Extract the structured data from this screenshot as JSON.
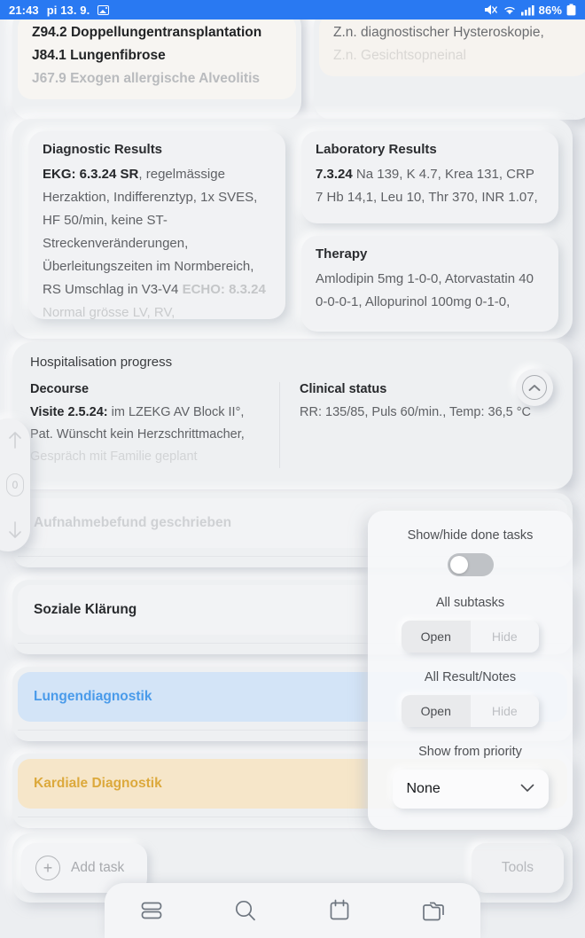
{
  "status_bar": {
    "time": "21:43",
    "date": "pi 13. 9.",
    "battery": "86%",
    "icons": [
      "image-icon",
      "mute-icon",
      "wifi-icon",
      "signal-icon",
      "battery-icon"
    ]
  },
  "diagnoses_left": {
    "lines": [
      "Z94.2 Doppellungentransplantation",
      "J84.1 Lungenfibrose",
      "J67.9 Exogen allergische Alveolitis"
    ]
  },
  "diagnoses_right": {
    "lines": [
      "Z.n. diagnostischer Hysteroskopie,",
      "Z.n. Gesichtsopneinal"
    ]
  },
  "diagnostic_results": {
    "title": "Diagnostic Results",
    "entry_label": "EKG: 6.3.24 SR",
    "entry_text": ", regelmässige Herzaktion, Indifferenztyp, 1x SVES, HF 50/min, keine ST-Streckenveränderungen, Überleitungszeiten im Normbereich, RS Umschlag in V3-V4",
    "faded_label": "ECHO: 8.3.24",
    "faded_text": " Normal grösse LV, RV,"
  },
  "laboratory_results": {
    "title": "Laboratory Results",
    "date": "7.3.24",
    "text": " Na 139, K 4.7, Krea 131, CRP 7 Hb 14,1, Leu 10, Thr 370, INR 1.07,"
  },
  "therapy": {
    "title": "Therapy",
    "text": "Amlodipin 5mg 1-0-0, Atorvastatin 40 0-0-0-1, Allopurinol 100mg 0-1-0,"
  },
  "hospitalisation": {
    "title": "Hospitalisation progress",
    "decourse_head": "Decourse",
    "decourse_label": "Visite 2.5.24:",
    "decourse_text": " im LZEKG AV Block II°, Pat. Wünscht kein Herzschrittmacher,",
    "decourse_faded": "Gespräch mit Familie geplant",
    "status_head": "Clinical status",
    "status_text": "RR: 135/85, Puls 60/min., Temp: 36,5 °C"
  },
  "side_nav": {
    "count": "0"
  },
  "tasks": [
    {
      "label": "Aufnahmebefund geschrieben",
      "style": "plain"
    },
    {
      "label": "Soziale Klärung",
      "style": "normal"
    },
    {
      "label": "Lungendiagnostik",
      "style": "blue"
    },
    {
      "label": "Kardiale Diagnostik",
      "style": "amber"
    }
  ],
  "action_bar": {
    "add_task": "Add task",
    "tools": "Tools"
  },
  "bottom_nav": {
    "items": [
      "list-icon",
      "search-icon",
      "calendar-icon",
      "folders-icon"
    ]
  },
  "popover": {
    "show_hide_done_label": "Show/hide done tasks",
    "toggle_state": "off",
    "all_subtasks_label": "All subtasks",
    "all_subtasks_open": "Open",
    "all_subtasks_hide": "Hide",
    "all_results_label": "All Result/Notes",
    "all_results_open": "Open",
    "all_results_hide": "Hide",
    "priority_label": "Show from priority",
    "priority_value": "None"
  },
  "colors": {
    "status_bar": "#2979f2",
    "background": "#eceef1",
    "task_blue_bg": "#d3e4f7",
    "task_blue_text": "#4a9bea",
    "task_amber_bg": "#f6e6c9",
    "task_amber_text": "#dca93c"
  }
}
